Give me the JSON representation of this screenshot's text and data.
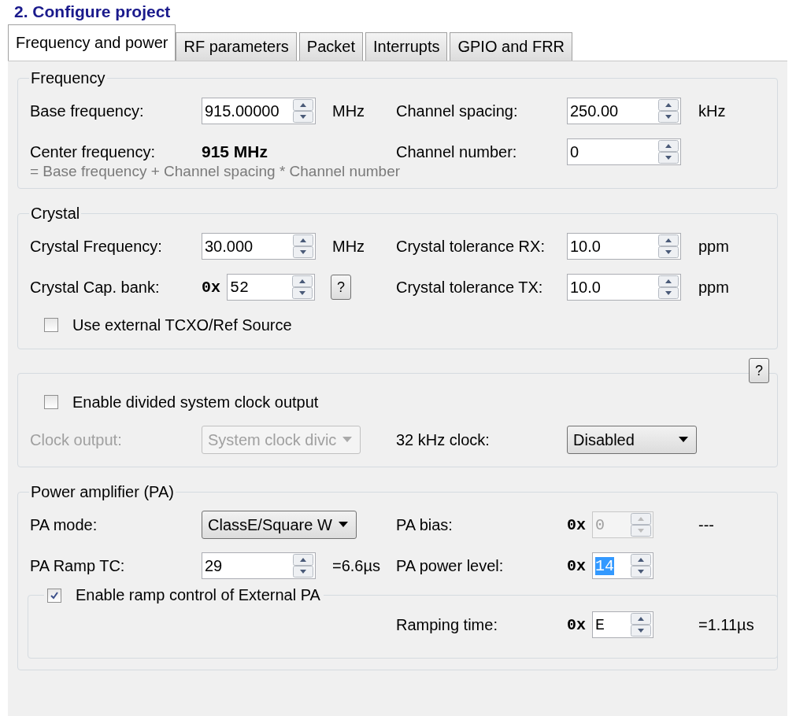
{
  "header": "2. Configure project",
  "tabs": [
    {
      "label": "Frequency and power",
      "selected": true
    },
    {
      "label": "RF parameters",
      "selected": false
    },
    {
      "label": "Packet",
      "selected": false
    },
    {
      "label": "Interrupts",
      "selected": false
    },
    {
      "label": "GPIO and FRR",
      "selected": false
    }
  ],
  "groups": [
    {
      "title": "Frequency",
      "items": [
        {
          "kind": "row",
          "left": {
            "label": "Base frequency:",
            "disabled": false,
            "control": {
              "kind": "spin",
              "value": "915.00000",
              "disabled": false,
              "highlighted": false
            },
            "unit": "MHz"
          },
          "right": {
            "label": "Channel spacing:",
            "disabled": false,
            "control": {
              "kind": "spin",
              "value": "250.00",
              "disabled": false,
              "highlighted": false
            },
            "unit": "kHz"
          }
        },
        {
          "kind": "row",
          "left": {
            "label": "Center frequency:",
            "disabled": false,
            "control": {
              "kind": "display",
              "value": "915 MHz",
              "disabled": false
            }
          },
          "right": {
            "label": "Channel number:",
            "disabled": false,
            "control": {
              "kind": "spin",
              "value": "0",
              "disabled": false,
              "highlighted": false
            }
          }
        },
        {
          "kind": "note",
          "text": "= Base frequency + Channel spacing * Channel number"
        }
      ]
    },
    {
      "title": "Crystal",
      "items": [
        {
          "kind": "row",
          "left": {
            "label": "Crystal Frequency:",
            "disabled": false,
            "control": {
              "kind": "spin",
              "value": "30.000",
              "disabled": false,
              "highlighted": false
            },
            "unit": "MHz"
          },
          "right": {
            "label": "Crystal tolerance RX:",
            "disabled": false,
            "control": {
              "kind": "spin",
              "value": "10.0",
              "disabled": false,
              "highlighted": false
            },
            "unit": "ppm"
          }
        },
        {
          "kind": "row",
          "left": {
            "label": "Crystal Cap. bank:",
            "disabled": false,
            "control": {
              "kind": "spin",
              "prefix": "0x",
              "value": "52",
              "disabled": false,
              "highlighted": false
            },
            "help": "?"
          },
          "right": {
            "label": "Crystal tolerance TX:",
            "disabled": false,
            "control": {
              "kind": "spin",
              "value": "10.0",
              "disabled": false,
              "highlighted": false
            },
            "unit": "ppm"
          }
        },
        {
          "kind": "checkbox",
          "label": "Use external TCXO/Ref Source",
          "checked": false
        }
      ]
    },
    {
      "help": "?",
      "items": [
        {
          "kind": "checkbox",
          "label": "Enable divided system clock output",
          "checked": false
        },
        {
          "kind": "row",
          "left": {
            "label": "Clock output:",
            "disabled": true,
            "control": {
              "kind": "dropdown",
              "value": "System clock divic",
              "disabled": true
            }
          },
          "right": {
            "label": "32 kHz clock:",
            "disabled": false,
            "control": {
              "kind": "dropdown",
              "value": "Disabled",
              "disabled": false
            }
          }
        }
      ]
    },
    {
      "title": "Power amplifier (PA)",
      "items": [
        {
          "kind": "row",
          "left": {
            "label": "PA mode:",
            "disabled": false,
            "control": {
              "kind": "dropdown",
              "value": "ClassE/Square W",
              "disabled": false
            }
          },
          "right": {
            "label": "PA bias:",
            "disabled": false,
            "control": {
              "kind": "spin",
              "prefix": "0x",
              "value": "0",
              "disabled": true,
              "highlighted": false
            },
            "unit": "---"
          }
        },
        {
          "kind": "row",
          "left": {
            "label": "PA Ramp TC:",
            "disabled": false,
            "control": {
              "kind": "spin",
              "value": "29",
              "disabled": false,
              "highlighted": false
            },
            "unit": "=6.6µs"
          },
          "right": {
            "label": "PA power level:",
            "disabled": false,
            "control": {
              "kind": "spin",
              "prefix": "0x",
              "value": "14",
              "disabled": false,
              "highlighted": true
            }
          }
        },
        {
          "kind": "subgroup",
          "checkbox": {
            "label": "Enable ramp control of External PA",
            "checked": true
          },
          "rows": [
            {
              "right": {
                "label": "Ramping time:",
                "disabled": false,
                "control": {
                  "kind": "spin",
                  "prefix": "0x",
                  "value": "E",
                  "disabled": false,
                  "highlighted": false
                },
                "unit": "=1.11µs"
              }
            }
          ]
        }
      ]
    }
  ]
}
